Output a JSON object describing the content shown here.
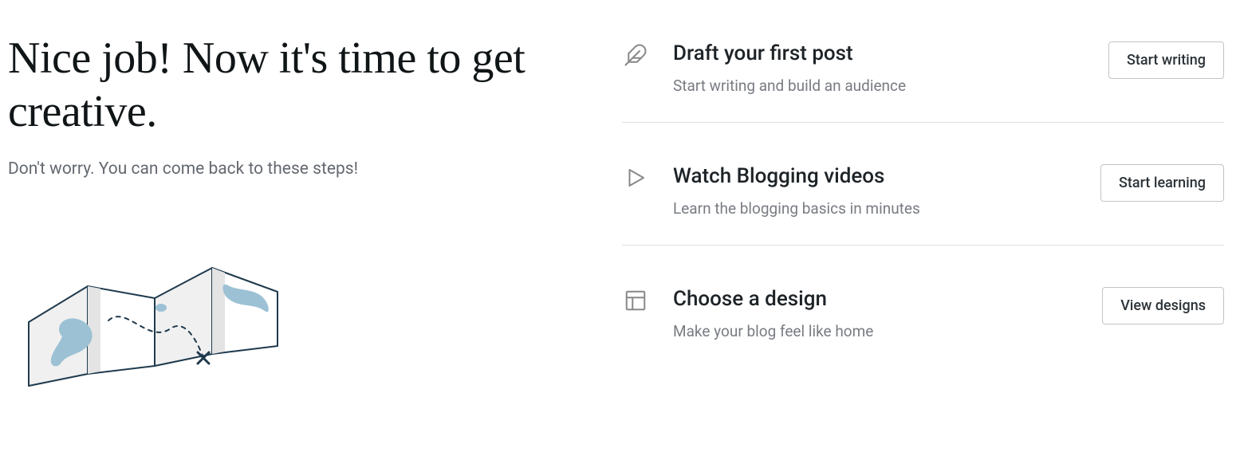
{
  "hero": {
    "headline": "Nice job! Now it's time to get creative.",
    "subhead": "Don't worry. You can come back to these steps!"
  },
  "tasks": [
    {
      "icon": "feather-icon",
      "title": "Draft your first post",
      "desc": "Start writing and build an audience",
      "button": "Start writing"
    },
    {
      "icon": "play-icon",
      "title": "Watch Blogging videos",
      "desc": "Learn the blogging basics in minutes",
      "button": "Start learning"
    },
    {
      "icon": "layout-icon",
      "title": "Choose a design",
      "desc": "Make your blog feel like home",
      "button": "View designs"
    }
  ]
}
